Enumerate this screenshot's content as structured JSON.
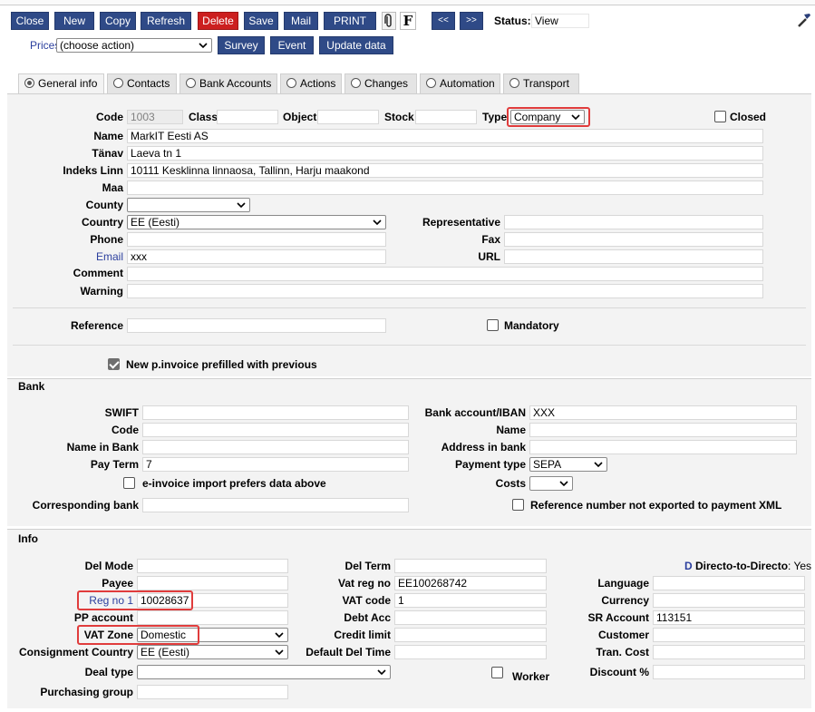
{
  "toolbar": {
    "close": "Close",
    "new": "New",
    "copy": "Copy",
    "refresh": "Refresh",
    "delete": "Delete",
    "save": "Save",
    "mail": "Mail",
    "print": "PRINT",
    "f_label": "F",
    "prev": "<<",
    "next": ">>",
    "status_label": "Status:",
    "status_value": "View",
    "prices_label": "Prices",
    "prices_value": "(choose action)",
    "survey": "Survey",
    "event": "Event",
    "update_data": "Update data"
  },
  "tabs": [
    {
      "label": "General info",
      "selected": true
    },
    {
      "label": "Contacts"
    },
    {
      "label": "Bank Accounts"
    },
    {
      "label": "Actions"
    },
    {
      "label": "Changes"
    },
    {
      "label": "Automation"
    },
    {
      "label": "Transport"
    }
  ],
  "general": {
    "code_label": "Code",
    "code_value": "1003",
    "class_label": "Class",
    "class_value": "",
    "object_label": "Object",
    "object_value": "",
    "stock_label": "Stock",
    "stock_value": "",
    "type_label": "Type",
    "type_value": "Company",
    "closed_label": "Closed",
    "name_label": "Name",
    "name_value": "MarkIT Eesti AS",
    "tanav_label": "Tänav",
    "tanav_value": "Laeva tn 1",
    "indeks_label": "Indeks Linn",
    "indeks_value": "10111 Kesklinna linnaosa, Tallinn, Harju maakond",
    "maa_label": "Maa",
    "maa_value": "",
    "county_label": "County",
    "county_value": "",
    "country_label": "Country",
    "country_value": "EE (Eesti)",
    "representative_label": "Representative",
    "representative_value": "",
    "phone_label": "Phone",
    "phone_value": "",
    "fax_label": "Fax",
    "fax_value": "",
    "email_label": "Email",
    "email_value": "xxx",
    "url_label": "URL",
    "url_value": "",
    "comment_label": "Comment",
    "comment_value": "",
    "warning_label": "Warning",
    "warning_value": "",
    "reference_label": "Reference",
    "reference_value": "",
    "mandatory_label": "Mandatory",
    "prefill_label": "New p.invoice prefilled with previous"
  },
  "bank": {
    "section_title": "Bank",
    "swift_label": "SWIFT",
    "swift_value": "",
    "code_label": "Code",
    "code_value": "",
    "name_in_bank_label": "Name in Bank",
    "name_in_bank_value": "",
    "pay_term_label": "Pay Term",
    "pay_term_value": "7",
    "iban_label": "Bank account/IBAN",
    "iban_value": "XXX",
    "name_label": "Name",
    "name_value": "",
    "address_label": "Address in bank",
    "address_value": "",
    "payment_type_label": "Payment type",
    "payment_type_value": "SEPA",
    "costs_label": "Costs",
    "costs_value": "",
    "einvoice_label": "e-invoice import prefers data above",
    "corresponding_label": "Corresponding bank",
    "corresponding_value": "",
    "refnum_label": "Reference number not exported to payment XML"
  },
  "info": {
    "section_title": "Info",
    "del_mode_label": "Del Mode",
    "del_mode_value": "",
    "payee_label": "Payee",
    "payee_value": "",
    "reg_no_label": "Reg no 1",
    "reg_no_value": "10028637",
    "pp_account_label": "PP account",
    "pp_account_value": "",
    "vat_zone_label": "VAT Zone",
    "vat_zone_value": "Domestic",
    "consignment_label": "Consignment Country",
    "consignment_value": "EE (Eesti)",
    "deal_type_label": "Deal type",
    "deal_type_value": "",
    "purchasing_label": "Purchasing group",
    "purchasing_value": "",
    "del_term_label": "Del Term",
    "del_term_value": "",
    "vat_reg_label": "Vat reg no",
    "vat_reg_value": "EE100268742",
    "vat_code_label": "VAT code",
    "vat_code_value": "1",
    "debt_acc_label": "Debt Acc",
    "debt_acc_value": "",
    "credit_limit_label": "Credit limit",
    "credit_limit_value": "",
    "default_del_time_label": "Default Del Time",
    "default_del_time_value": "",
    "worker_label": "Worker",
    "d2d_label": "Directo-to-Directo",
    "d2d_value": ": Yes",
    "language_label": "Language",
    "language_value": "",
    "currency_label": "Currency",
    "currency_value": "",
    "sr_account_label": "SR Account",
    "sr_account_value": "113151",
    "customer_label": "Customer",
    "customer_value": "",
    "tran_cost_label": "Tran. Cost",
    "tran_cost_value": "",
    "discount_label": "Discount %",
    "discount_value": ""
  }
}
